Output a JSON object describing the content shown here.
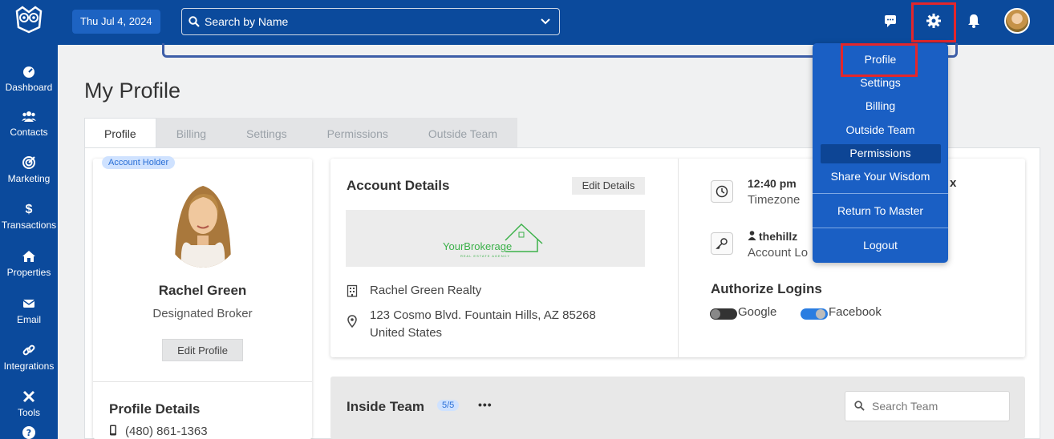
{
  "topbar": {
    "date": "Thu Jul 4, 2024",
    "search_placeholder": "Search by Name"
  },
  "sidebar": {
    "items": [
      {
        "label": "Dashboard",
        "icon": "dashboard-icon"
      },
      {
        "label": "Contacts",
        "icon": "contacts-icon"
      },
      {
        "label": "Marketing",
        "icon": "marketing-icon"
      },
      {
        "label": "Transactions",
        "icon": "dollar-icon"
      },
      {
        "label": "Properties",
        "icon": "home-icon"
      },
      {
        "label": "Email",
        "icon": "envelope-icon"
      },
      {
        "label": "Integrations",
        "icon": "link-icon"
      },
      {
        "label": "Tools",
        "icon": "tools-icon"
      }
    ]
  },
  "page": {
    "title": "My Profile",
    "tabs": [
      "Profile",
      "Billing",
      "Settings",
      "Permissions",
      "Outside Team"
    ]
  },
  "profile": {
    "badge": "Account Holder",
    "name": "Rachel Green",
    "role": "Designated Broker",
    "edit_button": "Edit Profile",
    "details_title": "Profile Details",
    "phone": "(480) 861-1363"
  },
  "account": {
    "title": "Account Details",
    "edit_button": "Edit Details",
    "logo_text": "YourBrokerage",
    "logo_sub": "REAL ESTATE AGENCY",
    "company": "Rachel Green Realty",
    "address_line1": "123 Cosmo Blvd. Fountain Hills, AZ 85268",
    "address_line2": "United States",
    "time": "12:40 pm",
    "time_suffix": "x",
    "timezone_label": "Timezone",
    "username": "thehillz",
    "account_login_label": "Account Lo",
    "authorize_title": "Authorize Logins",
    "google_label": "Google",
    "facebook_label": "Facebook"
  },
  "team": {
    "title": "Inside Team",
    "count": "5/5",
    "more": "•••",
    "search_placeholder": "Search Team"
  },
  "dropdown": {
    "items": [
      "Profile",
      "Settings",
      "Billing",
      "Outside Team",
      "Permissions",
      "Share Your Wisdom"
    ],
    "return_master": "Return To Master",
    "logout": "Logout"
  },
  "colors": {
    "brand_blue": "#0b4a9c",
    "dropdown_blue": "#1a5fc4",
    "highlight_red": "#e3262b",
    "facebook_toggle": "#2a7de1"
  }
}
